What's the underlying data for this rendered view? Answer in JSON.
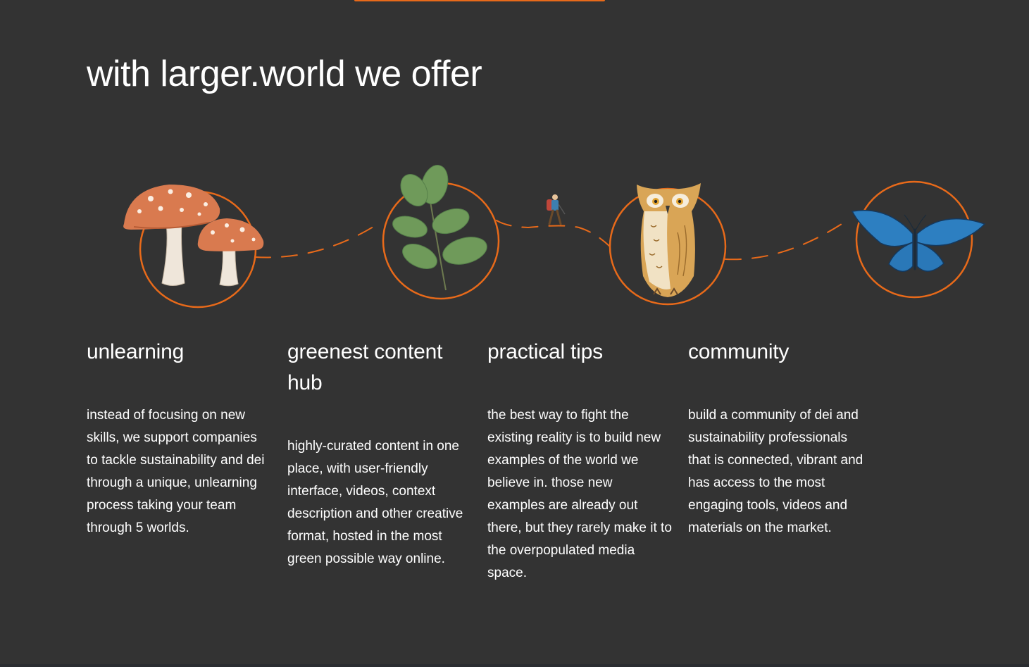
{
  "section": {
    "heading": "with larger.world we offer",
    "accent_color": "#e86a1a",
    "background_color": "#333333"
  },
  "illustrations": [
    {
      "icon": "mushrooms-icon"
    },
    {
      "icon": "leaf-sprig-icon"
    },
    {
      "icon": "hiker-icon"
    },
    {
      "icon": "owl-icon"
    },
    {
      "icon": "butterfly-icon"
    }
  ],
  "features": [
    {
      "title": "unlearning",
      "description": "instead of focusing on new skills, we support companies to tackle sustainability and dei through a unique, unlearning process taking your team through 5 worlds."
    },
    {
      "title": "greenest content hub",
      "description": "highly-curated content in one place, with user-friendly interface, videos, context description and other creative format, hosted in the most green possible way online."
    },
    {
      "title": "practical tips",
      "description": "the best way to fight the existing reality is to build new examples of the world we believe in. those new examples are already out there, but they rarely make it to the overpopulated media space."
    },
    {
      "title": "community",
      "description": "build a community of dei and sustainability professionals that is connected, vibrant and has access to the most engaging tools, videos and materials on the market."
    }
  ]
}
